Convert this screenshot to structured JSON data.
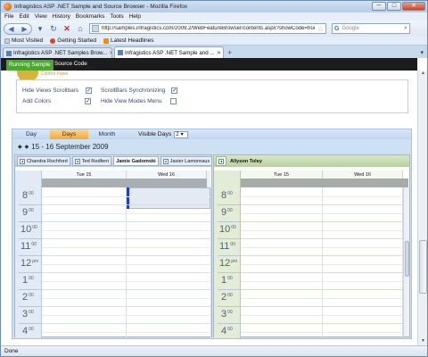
{
  "window": {
    "title": "Infragistics ASP .NET Sample and Source Browser - Mozilla Firefox",
    "minimize": "─",
    "maximize": "□",
    "close": "✕"
  },
  "menu": [
    "File",
    "Edit",
    "View",
    "History",
    "Bookmarks",
    "Tools",
    "Help"
  ],
  "nav": {
    "url": "http://samples.infragistics.com/2009.2/WebFeatureBrowser/contents.aspx?showCode=true&t=WebS",
    "search_placeholder": "Google"
  },
  "bookmarks": [
    "Most Visited",
    "Getting Started",
    "Latest Headlines"
  ],
  "tabs": [
    {
      "label": "Infragistics ASP .NET Samples Brow...",
      "active": false
    },
    {
      "label": "Infragistics ASP .NET Sample and ...",
      "active": true
    }
  ],
  "page": {
    "running_sample": "Running Sample",
    "source_code": "Source Code",
    "control_panel_title": "Control Panel",
    "options": [
      {
        "label": "Hide Views Scrollbars",
        "checked": true
      },
      {
        "label": "ScrollBars Synchronizing",
        "checked": true
      },
      {
        "label": "Add Colors",
        "checked": true
      },
      {
        "label": "Hide View Modes Menu",
        "checked": false
      }
    ]
  },
  "scheduler": {
    "view_tabs": [
      {
        "label": "Day",
        "active": false
      },
      {
        "label": "Days",
        "active": true
      },
      {
        "label": "Month",
        "active": false
      }
    ],
    "visible_days_label": "Visible Days",
    "visible_days_value": "2",
    "date_range": "15 - 16 September 2009",
    "left_resources": [
      "Chandra Rochford",
      "Ted Redfern",
      "Jamie Gadomski",
      "Javier Lamoreaux"
    ],
    "right_resources": [
      "Allyson Toley"
    ],
    "days": [
      "Tue 15",
      "Wed 16"
    ],
    "hours": [
      {
        "h": "8",
        "m": "00"
      },
      {
        "h": "9",
        "m": "00"
      },
      {
        "h": "10",
        "m": "00"
      },
      {
        "h": "11",
        "m": "00"
      },
      {
        "h": "12",
        "m": "pm"
      },
      {
        "h": "1",
        "m": "00"
      },
      {
        "h": "2",
        "m": "00"
      },
      {
        "h": "3",
        "m": "00"
      },
      {
        "h": "4",
        "m": "00"
      }
    ],
    "appointment_color": "#1f3fbf",
    "selected_tab_color": "#f2a93b"
  },
  "status": "Done"
}
